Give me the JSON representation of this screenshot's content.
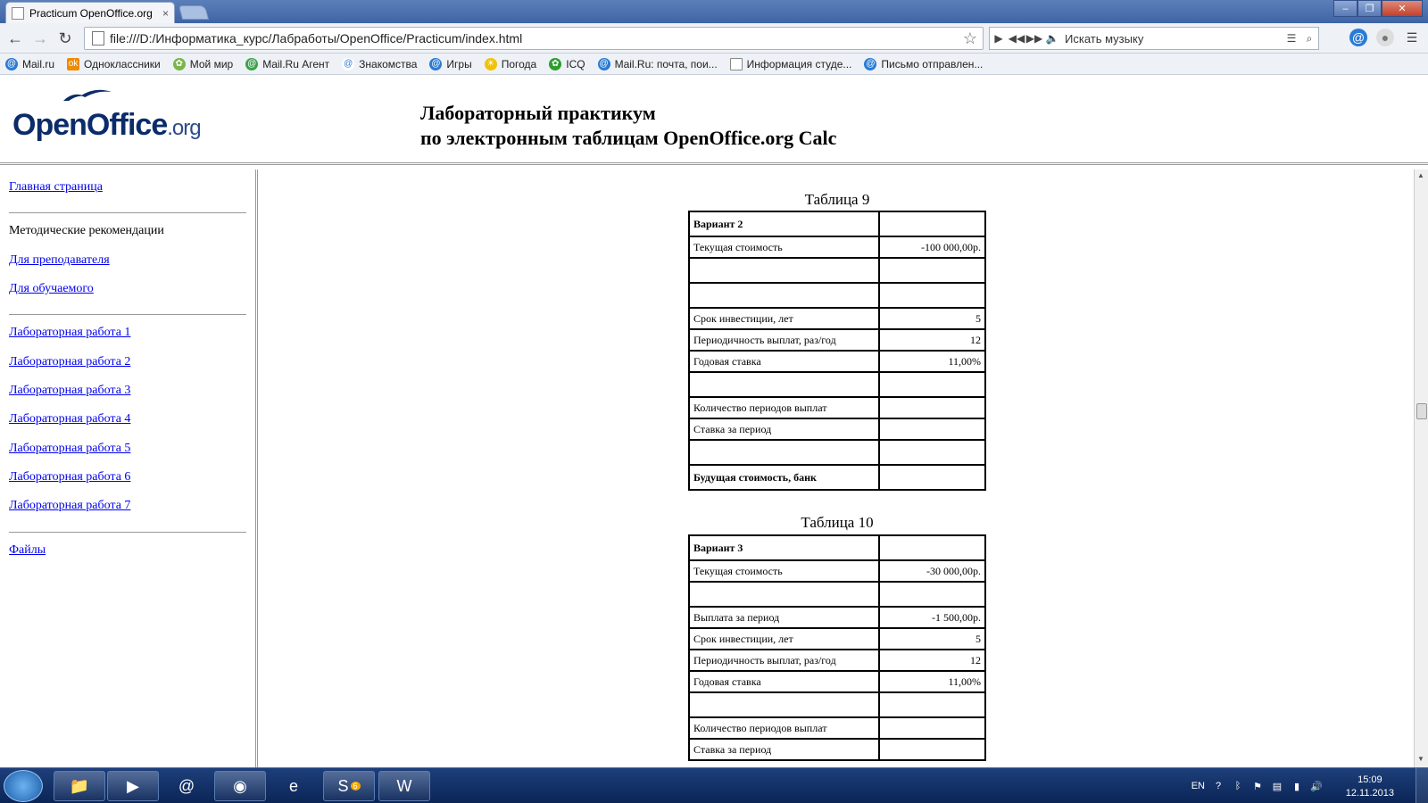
{
  "browser": {
    "tab_title": "Practicum OpenOffice.org",
    "tab_close": "×",
    "url": "file:///D:/Информатика_курс/Лабработы/OpenOffice/Practicum/index.html",
    "music_search_placeholder": "Искать музыку",
    "bookmarks": [
      "Mail.ru",
      "Одноклассники",
      "Мой мир",
      "Mail.Ru Агент",
      "Знакомства",
      "Игры",
      "Погода",
      "ICQ",
      "Mail.Ru: почта, пои...",
      "Информация студе...",
      "Письмо отправлен..."
    ]
  },
  "header": {
    "logo_main": "OpenOffice",
    "logo_suffix": ".org",
    "title_line1": "Лабораторный практикум",
    "title_line2": "по электронным таблицам OpenOffice.org Calc"
  },
  "sidebar": {
    "home": "Главная страница",
    "methods": "Методические рекомендации",
    "for_teacher": "Для преподавателя",
    "for_student": "Для обучаемого",
    "labs": [
      "Лабораторная работа 1",
      "Лабораторная работа 2",
      "Лабораторная работа 3",
      "Лабораторная работа 4",
      "Лабораторная работа 5",
      "Лабораторная работа 6",
      "Лабораторная работа 7"
    ],
    "files": "Файлы"
  },
  "tables": [
    {
      "caption": "Таблица 9",
      "rows": [
        {
          "label": "Вариант 2",
          "value": "",
          "bold": true
        },
        {
          "label": "Текущая стоимость",
          "value": "-100 000,00р."
        },
        {
          "label": "",
          "value": ""
        },
        {
          "label": "",
          "value": ""
        },
        {
          "label": "Срок инвестиции, лет",
          "value": "5"
        },
        {
          "label": "Периодичность выплат, раз/год",
          "value": "12"
        },
        {
          "label": "Годовая ставка",
          "value": "11,00%"
        },
        {
          "label": "",
          "value": ""
        },
        {
          "label": "Количество периодов выплат",
          "value": ""
        },
        {
          "label": "Ставка за период",
          "value": ""
        },
        {
          "label": "",
          "value": ""
        },
        {
          "label": "Будущая стоимость, банк",
          "value": "",
          "bold": true
        }
      ]
    },
    {
      "caption": "Таблица 10",
      "rows": [
        {
          "label": "Вариант 3",
          "value": "",
          "bold": true
        },
        {
          "label": "Текущая стоимость",
          "value": "-30 000,00р."
        },
        {
          "label": "",
          "value": ""
        },
        {
          "label": "Выплата за период",
          "value": "-1 500,00р."
        },
        {
          "label": "Срок инвестиции, лет",
          "value": "5"
        },
        {
          "label": "Периодичность выплат, раз/год",
          "value": "12"
        },
        {
          "label": "Годовая ставка",
          "value": "11,00%"
        },
        {
          "label": "",
          "value": ""
        },
        {
          "label": "Количество периодов выплат",
          "value": ""
        },
        {
          "label": "Ставка за период",
          "value": ""
        }
      ]
    }
  ],
  "taskbar": {
    "lang": "EN",
    "time": "15:09",
    "date": "12.11.2013",
    "skype_badge": "6"
  },
  "colors": {
    "titlebar": "#3e64a5",
    "link": "#0000ee",
    "taskbar": "#0b2556"
  }
}
